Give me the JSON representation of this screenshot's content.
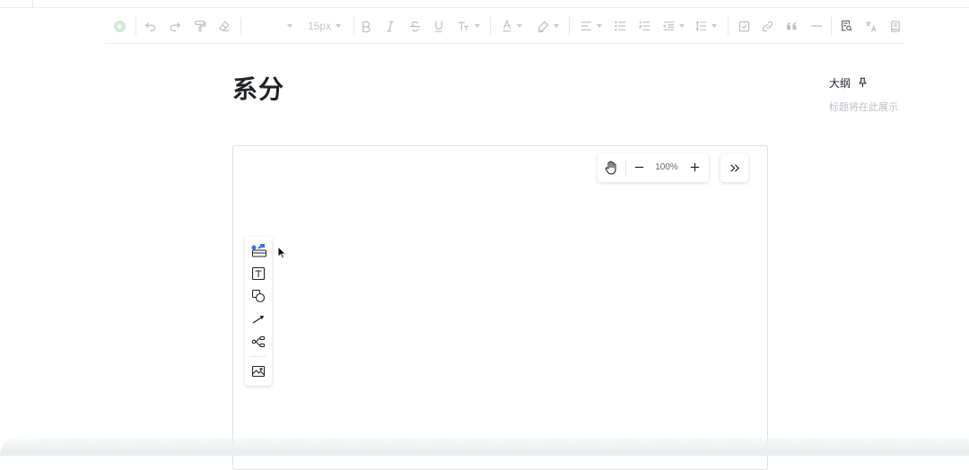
{
  "toolbar": {
    "heading_placeholder": "",
    "font_size": "15px",
    "icons": [
      "add-icon",
      "undo-icon",
      "redo-icon",
      "format-painter-icon",
      "eraser-icon",
      "bold-icon",
      "italic-icon",
      "strikethrough-icon",
      "underline-icon",
      "text-style-icon",
      "font-color-icon",
      "highlight-icon",
      "align-icon",
      "bullet-list-icon",
      "numbered-list-icon",
      "indent-icon",
      "line-spacing-icon",
      "checkbox-icon",
      "link-icon",
      "quote-icon",
      "divider-icon",
      "find-icon",
      "translate-icon",
      "book-icon"
    ]
  },
  "document": {
    "title": "系分"
  },
  "outline": {
    "title": "大纲",
    "hint": "标题将在此展示"
  },
  "whiteboard": {
    "zoom": "100%",
    "tools": [
      "template-icon",
      "text-box-icon",
      "shape-icon",
      "connector-icon",
      "mindmap-icon",
      "image-icon"
    ]
  },
  "colors": {
    "accent_green": "#cdebd0",
    "icon_gray": "#bbbfc4",
    "text": "#1f2329"
  }
}
